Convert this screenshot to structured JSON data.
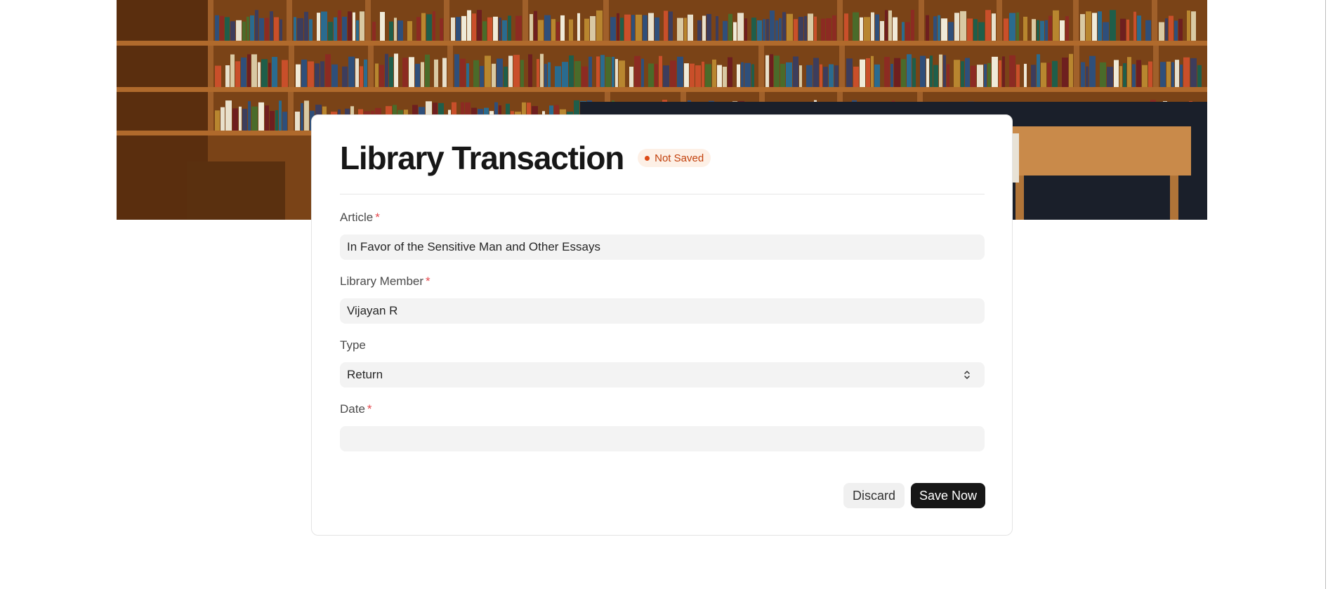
{
  "form": {
    "title": "Library Transaction",
    "status_badge": "Not Saved",
    "fields": [
      {
        "label": "Article",
        "required_mark": "*",
        "value": "In Favor of the Sensitive Man and Other Essays"
      },
      {
        "label": "Library Member",
        "required_mark": "*",
        "value": "Vijayan R"
      },
      {
        "label": "Type",
        "value": "Return"
      },
      {
        "label": "Date",
        "required_mark": "*",
        "value": ""
      }
    ],
    "actions": {
      "discard_label": "Discard",
      "save_label": "Save Now"
    }
  },
  "colors": {
    "badge_text": "#c2410c",
    "badge_bg": "#fdf0e6",
    "required": "#e5484d",
    "primary_button": "#171717"
  },
  "icons": {
    "banner": "library-bookshelves-image",
    "type_select": "select-updown-caret-icon",
    "status": "status-dot-icon"
  }
}
